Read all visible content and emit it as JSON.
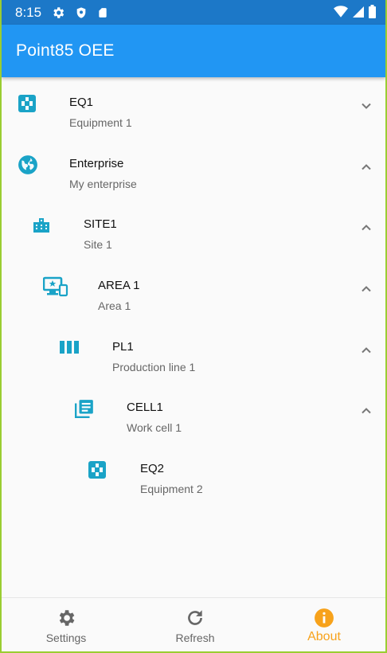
{
  "status_bar": {
    "time": "8:15",
    "icons": [
      "gear-icon",
      "shield-icon",
      "sd-card-icon"
    ],
    "right_icons": [
      "wifi-icon",
      "signal-icon",
      "battery-icon"
    ]
  },
  "app_bar": {
    "title": "Point85 OEE"
  },
  "tree": [
    {
      "title": "EQ1",
      "subtitle": "Equipment 1",
      "icon": "equipment-icon",
      "expanded": false
    },
    {
      "title": "Enterprise",
      "subtitle": "My enterprise",
      "icon": "globe-icon",
      "expanded": true
    },
    {
      "title": "SITE1",
      "subtitle": "Site 1",
      "icon": "building-icon",
      "expanded": true
    },
    {
      "title": "AREA 1",
      "subtitle": "Area 1",
      "icon": "devices-icon",
      "expanded": true
    },
    {
      "title": "PL1",
      "subtitle": "Production line 1",
      "icon": "production-line-icon",
      "expanded": true
    },
    {
      "title": "CELL1",
      "subtitle": "Work cell 1",
      "icon": "work-cell-icon",
      "expanded": true
    },
    {
      "title": "EQ2",
      "subtitle": "Equipment 2",
      "icon": "equipment-icon",
      "expanded": null
    }
  ],
  "bottom_nav": [
    {
      "label": "Settings",
      "icon": "gear-icon",
      "active": false
    },
    {
      "label": "Refresh",
      "icon": "refresh-icon",
      "active": false
    },
    {
      "label": "About",
      "icon": "info-icon",
      "active": true
    }
  ],
  "colors": {
    "primary": "#2196f3",
    "status_bar": "#1c78c8",
    "icon_accent": "#1aa3c7",
    "active_nav": "#f7a21b"
  }
}
